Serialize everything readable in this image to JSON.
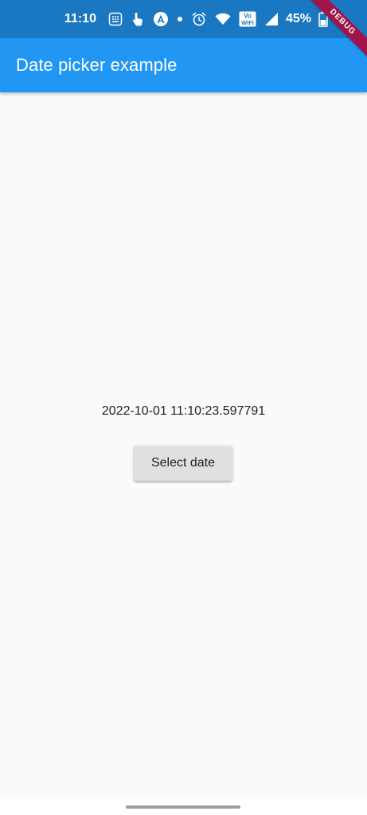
{
  "status_bar": {
    "time": "11:10",
    "battery_percent": "45%",
    "icons": [
      "keypad-icon",
      "touch-icon",
      "android-icon",
      "dot-icon",
      "alarm-icon",
      "wifi-icon",
      "vowifi-icon",
      "signal-icon",
      "battery-icon"
    ],
    "vowifi_label_top": "Vo",
    "vowifi_label_bottom": "WiFi"
  },
  "app_bar": {
    "title": "Date picker example",
    "color": "#2196f3"
  },
  "debug_banner": {
    "label": "DEBUG",
    "color": "#a0154a"
  },
  "main": {
    "date_value": "2022-10-01 11:10:23.597791",
    "select_button_label": "Select date"
  }
}
